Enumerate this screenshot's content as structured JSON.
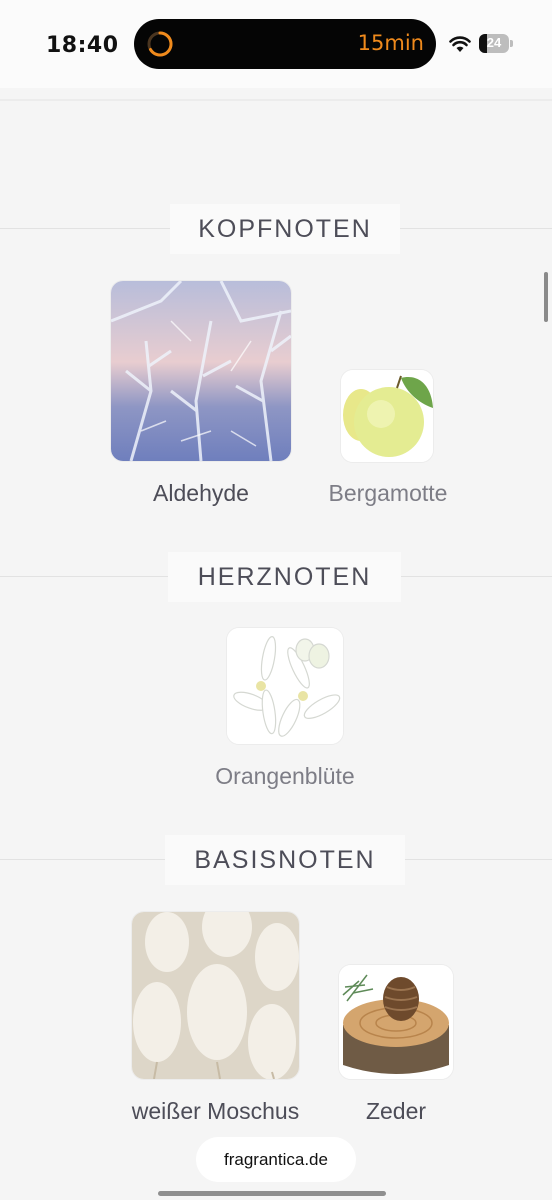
{
  "status_bar": {
    "time": "18:40",
    "timer": "15min",
    "battery_level": "24",
    "timer_color": "#f08a1c"
  },
  "sections": {
    "top": {
      "title": "KOPFNOTEN",
      "notes": [
        {
          "name": "Aldehyde",
          "icon": "frost-crystals-image"
        },
        {
          "name": "Bergamotte",
          "icon": "bergamot-fruit-image"
        }
      ]
    },
    "heart": {
      "title": "HERZNOTEN",
      "notes": [
        {
          "name": "Orangenblüte",
          "icon": "orange-blossom-image"
        }
      ]
    },
    "base": {
      "title": "BASISNOTEN",
      "notes": [
        {
          "name": "weißer Moschus",
          "icon": "white-fluffy-grass-image"
        },
        {
          "name": "Zeder",
          "icon": "cedar-wood-slice-image"
        }
      ]
    }
  },
  "footer": {
    "source": "fragrantica.de"
  }
}
